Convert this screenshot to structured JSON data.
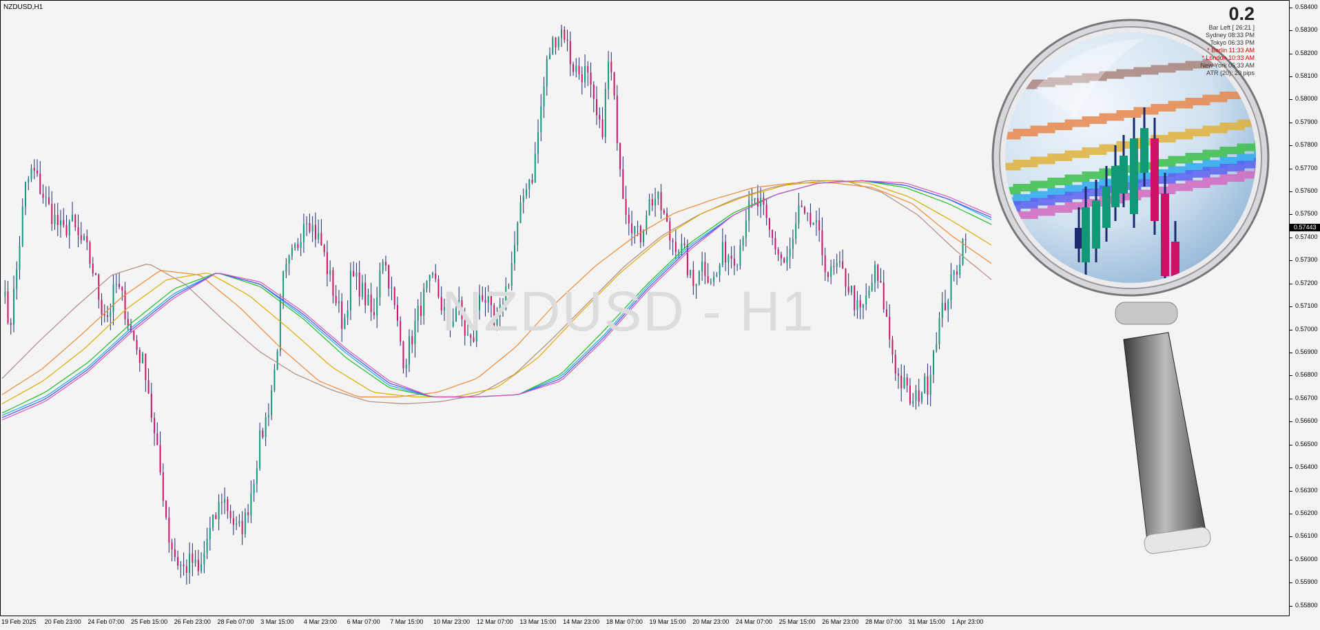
{
  "symbol_label": "NZDUSD,H1",
  "watermark": "NZDUSD - H1",
  "info_panel": {
    "spread": "0.2",
    "rows": [
      {
        "label": "Bar Left",
        "value": "[ 26:21 ]",
        "highlight": false
      },
      {
        "label": "Sydney",
        "value": "08:33 PM",
        "highlight": false
      },
      {
        "label": "Tokyo",
        "value": "06:33 PM",
        "highlight": false
      },
      {
        "label": "* Berlin",
        "value": "11:33 AM",
        "highlight": true
      },
      {
        "label": "* London",
        "value": "10:33 AM",
        "highlight": true
      },
      {
        "label": "New York",
        "value": "05:33 AM",
        "highlight": false
      },
      {
        "label": "ATR (20):",
        "value": "20 pips",
        "highlight": false
      }
    ]
  },
  "current_price": "0.57443",
  "colors": {
    "bull_candle": "#119977",
    "bear_candle": "#cc1166",
    "wick": "#1a2a6e",
    "bands": [
      "#b08a80",
      "#ee8833",
      "#ddaa00",
      "#22bb22",
      "#22aaee",
      "#4455ee",
      "#dd55bb"
    ]
  },
  "chart_data": {
    "type": "line",
    "title": "NZDUSD,H1",
    "xlabel": "",
    "ylabel": "",
    "ylim": [
      0.5579,
      0.5842
    ],
    "y_ticks": [
      "0.58400",
      "0.58300",
      "0.58200",
      "0.58100",
      "0.58000",
      "0.57900",
      "0.57800",
      "0.57700",
      "0.57600",
      "0.57500",
      "0.57400",
      "0.57300",
      "0.57200",
      "0.57100",
      "0.57000",
      "0.56900",
      "0.56800",
      "0.56700",
      "0.56600",
      "0.56500",
      "0.56400",
      "0.56300",
      "0.56200",
      "0.56100",
      "0.56000",
      "0.55900",
      "0.55800"
    ],
    "x_ticks": [
      "19 Feb 2025",
      "20 Feb 23:00",
      "24 Feb 07:00",
      "25 Feb 15:00",
      "26 Feb 23:00",
      "28 Feb 07:00",
      "3 Mar 15:00",
      "4 Mar 23:00",
      "6 Mar 07:00",
      "7 Mar 15:00",
      "10 Mar 23:00",
      "12 Mar 07:00",
      "13 Mar 15:00",
      "14 Mar 23:00",
      "18 Mar 07:00",
      "19 Mar 15:00",
      "20 Mar 23:00",
      "24 Mar 07:00",
      "25 Mar 15:00",
      "26 Mar 23:00",
      "28 Mar 07:00",
      "31 Mar 15:00",
      "1 Apr 23:00"
    ],
    "price_series": [
      0.572,
      0.5701,
      0.5728,
      0.5761,
      0.577,
      0.5762,
      0.5754,
      0.5748,
      0.5742,
      0.5748,
      0.574,
      0.5736,
      0.5726,
      0.5711,
      0.5706,
      0.572,
      0.5712,
      0.5699,
      0.569,
      0.5682,
      0.5655,
      0.5635,
      0.561,
      0.56,
      0.5596,
      0.56,
      0.5593,
      0.5609,
      0.5617,
      0.5628,
      0.5621,
      0.5612,
      0.5617,
      0.5633,
      0.5652,
      0.5664,
      0.5684,
      0.5721,
      0.573,
      0.5738,
      0.5752,
      0.5744,
      0.5738,
      0.5725,
      0.5713,
      0.5702,
      0.5723,
      0.572,
      0.5713,
      0.5704,
      0.5735,
      0.5722,
      0.5704,
      0.5686,
      0.5697,
      0.5709,
      0.5718,
      0.5721,
      0.571,
      0.5702,
      0.5712,
      0.5699,
      0.5693,
      0.5718,
      0.5712,
      0.5699,
      0.5712,
      0.5726,
      0.5745,
      0.5764,
      0.5768,
      0.5796,
      0.582,
      0.5828,
      0.5831,
      0.5816,
      0.5812,
      0.5812,
      0.5796,
      0.5784,
      0.5819,
      0.5788,
      0.5756,
      0.5747,
      0.5739,
      0.5754,
      0.5758,
      0.5752,
      0.574,
      0.5738,
      0.5732,
      0.5718,
      0.573,
      0.5725,
      0.5721,
      0.5734,
      0.5733,
      0.5733,
      0.575,
      0.5755,
      0.5754,
      0.5743,
      0.5736,
      0.5729,
      0.5734,
      0.5752,
      0.5746,
      0.5747,
      0.5735,
      0.5723,
      0.5727,
      0.5723,
      0.5716,
      0.5706,
      0.5714,
      0.5725,
      0.5715,
      0.5696,
      0.568,
      0.5675,
      0.5667,
      0.5674,
      0.5677,
      0.5697,
      0.5709,
      0.5719,
      0.5729,
      0.5744
    ],
    "series": [
      {
        "values": [
          0.5679,
          0.5695,
          0.571,
          0.5724,
          0.5729,
          0.572,
          0.5705,
          0.5691,
          0.5681,
          0.5674,
          0.5669,
          0.5668,
          0.5669,
          0.5672,
          0.5681,
          0.5696,
          0.5712,
          0.5728,
          0.5741,
          0.575,
          0.5757,
          0.5762,
          0.5765,
          0.5765,
          0.576,
          0.575,
          0.5735,
          0.5722
        ]
      },
      {
        "values": [
          0.5672,
          0.5683,
          0.5698,
          0.5714,
          0.5726,
          0.5724,
          0.571,
          0.5693,
          0.5678,
          0.5671,
          0.5671,
          0.5673,
          0.5679,
          0.5693,
          0.5712,
          0.5728,
          0.5741,
          0.5751,
          0.5757,
          0.5762,
          0.5764,
          0.5764,
          0.5762,
          0.5755,
          0.5741,
          0.5729
        ]
      },
      {
        "values": [
          0.5668,
          0.5678,
          0.5692,
          0.5709,
          0.5722,
          0.5725,
          0.5715,
          0.57,
          0.5684,
          0.5673,
          0.5671,
          0.5671,
          0.5675,
          0.5688,
          0.5707,
          0.5725,
          0.574,
          0.5751,
          0.5758,
          0.5763,
          0.5765,
          0.5764,
          0.5758,
          0.5748,
          0.5737
        ]
      },
      {
        "values": [
          0.5664,
          0.5673,
          0.5686,
          0.5703,
          0.5718,
          0.5725,
          0.5719,
          0.5705,
          0.5688,
          0.5675,
          0.5671,
          0.5671,
          0.5672,
          0.5681,
          0.57,
          0.572,
          0.5738,
          0.5751,
          0.5759,
          0.5764,
          0.5765,
          0.5762,
          0.5755,
          0.5746
        ]
      },
      {
        "values": [
          0.5663,
          0.5671,
          0.5684,
          0.5701,
          0.5716,
          0.5725,
          0.572,
          0.5706,
          0.569,
          0.5676,
          0.5671,
          0.5671,
          0.5672,
          0.568,
          0.5698,
          0.5719,
          0.5737,
          0.575,
          0.5759,
          0.5764,
          0.5765,
          0.5763,
          0.5757,
          0.5748
        ]
      },
      {
        "values": [
          0.5662,
          0.567,
          0.5683,
          0.57,
          0.5715,
          0.5725,
          0.572,
          0.5707,
          0.5691,
          0.5677,
          0.5671,
          0.5671,
          0.5672,
          0.5679,
          0.5697,
          0.5718,
          0.5736,
          0.575,
          0.5759,
          0.5764,
          0.5765,
          0.5763,
          0.5757,
          0.5749
        ]
      },
      {
        "values": [
          0.5661,
          0.5669,
          0.5682,
          0.5699,
          0.5714,
          0.5725,
          0.5721,
          0.5708,
          0.5692,
          0.5678,
          0.5671,
          0.5671,
          0.5672,
          0.5678,
          0.5696,
          0.5717,
          0.5735,
          0.575,
          0.5759,
          0.5764,
          0.5765,
          0.5764,
          0.5758,
          0.575
        ]
      }
    ],
    "grid": false,
    "legend": "none"
  }
}
